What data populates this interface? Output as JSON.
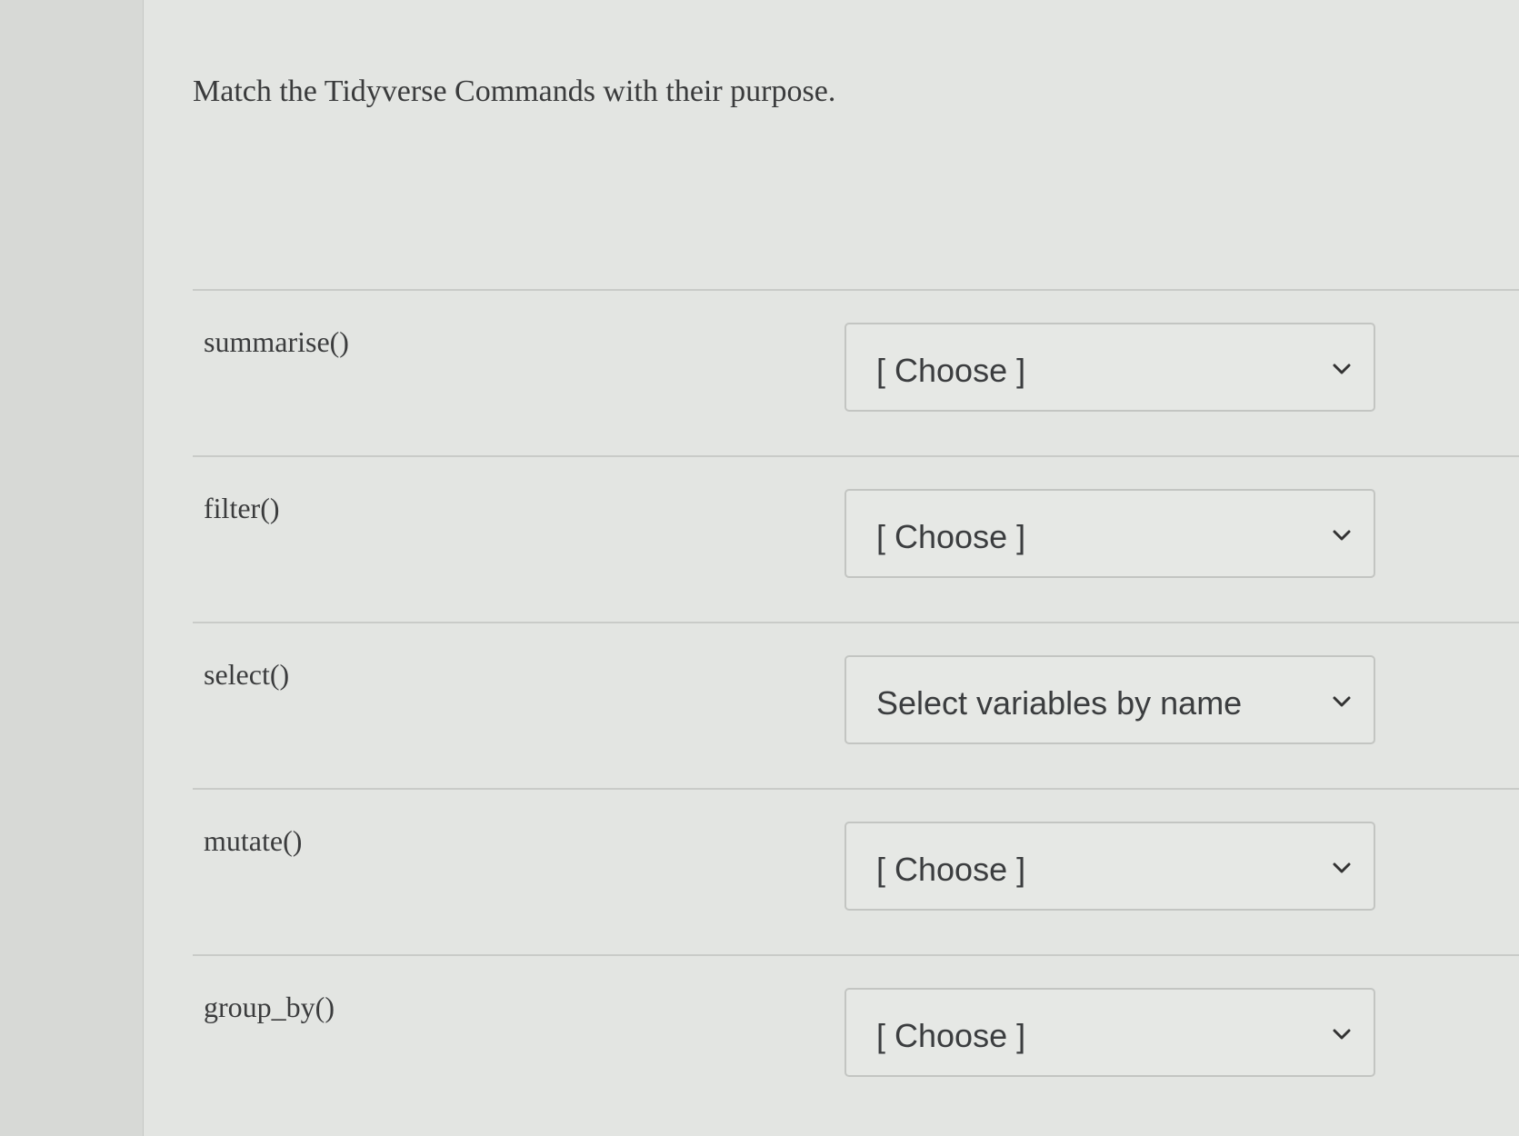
{
  "question": {
    "text": "Match the Tidyverse Commands with their purpose."
  },
  "rows": [
    {
      "label": "summarise()",
      "selected": "[ Choose ]"
    },
    {
      "label": "filter()",
      "selected": "[ Choose ]"
    },
    {
      "label": "select()",
      "selected": "Select variables by name"
    },
    {
      "label": "mutate()",
      "selected": "[ Choose ]"
    },
    {
      "label": "group_by()",
      "selected": "[ Choose ]"
    }
  ],
  "icons": {
    "dropdown": "chevron-down-icon"
  },
  "colors": {
    "text": "#3b3c3d",
    "divider": "#c9cbc8",
    "dropdown_border": "#c3c5c2"
  }
}
